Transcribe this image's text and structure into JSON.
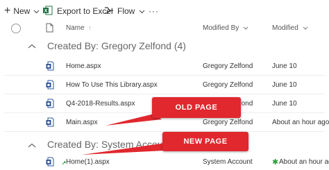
{
  "toolbar": {
    "new_label": "New",
    "export_label": "Export to Excel",
    "flow_label": "Flow",
    "more_label": "···"
  },
  "columns": {
    "name": "Name",
    "modified_by": "Modified By",
    "modified": "Modified"
  },
  "groups": [
    {
      "title": "Created By: Gregory Zelfond (4)",
      "rows": [
        {
          "name": "Home.aspx",
          "modified_by": "Gregory Zelfond",
          "modified": "June 10"
        },
        {
          "name": "How To Use This Library.aspx",
          "modified_by": "Gregory Zelfond",
          "modified": "June 10"
        },
        {
          "name": "Q4-2018-Results.aspx",
          "modified_by": "Gregory Zelfond",
          "modified": "June 10"
        },
        {
          "name": "Main.aspx",
          "modified_by": "Gregory Zelfond",
          "modified": "About an hour ago"
        }
      ]
    },
    {
      "title": "Created By: System Account",
      "rows": [
        {
          "name": "Home(1).aspx",
          "modified_by": "System Account",
          "modified": "About an hour ago"
        }
      ]
    }
  ],
  "callouts": {
    "old": "OLD PAGE",
    "new": "NEW PAGE"
  },
  "colors": {
    "accent": "#0078d4",
    "callout_red": "#e0282e",
    "new_star": "#2a9d3a",
    "excel_green": "#217346",
    "file_blue": "#2b579a"
  }
}
